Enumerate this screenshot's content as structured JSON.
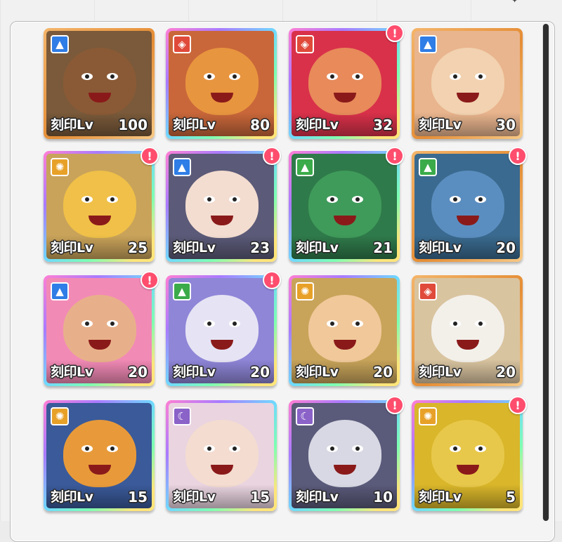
{
  "colors": {
    "water": "#2f7de6",
    "fire": "#e04a3a",
    "wood": "#3bab4a",
    "light": "#e8a128",
    "dark": "#8a62c8",
    "alert": "#ff4d6d"
  },
  "cards": [
    {
      "lv_label": "刻印Lv",
      "lv": "100",
      "element": "water",
      "elem_glyph": "▲",
      "badge": false,
      "frame": "gold",
      "bg": "#7a5a3a",
      "face": "#8a5a36"
    },
    {
      "lv_label": "刻印Lv",
      "lv": "80",
      "element": "fire",
      "elem_glyph": "◈",
      "badge": false,
      "frame": "rainbow",
      "bg": "#c9673a",
      "face": "#e8953f"
    },
    {
      "lv_label": "刻印Lv",
      "lv": "32",
      "element": "fire",
      "elem_glyph": "◈",
      "badge": true,
      "badge_text": "!",
      "frame": "rainbow",
      "bg": "#d9314a",
      "face": "#e88a5a"
    },
    {
      "lv_label": "刻印Lv",
      "lv": "30",
      "element": "water",
      "elem_glyph": "▲",
      "badge": false,
      "frame": "gold",
      "bg": "#e9b58e",
      "face": "#f2d2b0"
    },
    {
      "lv_label": "刻印Lv",
      "lv": "25",
      "element": "light",
      "elem_glyph": "✺",
      "badge": true,
      "badge_text": "!",
      "frame": "rainbow",
      "bg": "#c9a35a",
      "face": "#f0c048"
    },
    {
      "lv_label": "刻印Lv",
      "lv": "23",
      "element": "water",
      "elem_glyph": "▲",
      "badge": true,
      "badge_text": "!",
      "frame": "rainbow",
      "bg": "#5b5a78",
      "face": "#f3ddd0"
    },
    {
      "lv_label": "刻印Lv",
      "lv": "21",
      "element": "wood",
      "elem_glyph": "▲",
      "badge": true,
      "badge_text": "!",
      "frame": "rainbow",
      "bg": "#2f7a4a",
      "face": "#3f9b5a"
    },
    {
      "lv_label": "刻印Lv",
      "lv": "20",
      "element": "wood",
      "elem_glyph": "▲",
      "badge": true,
      "badge_text": "!",
      "frame": "gold",
      "bg": "#3a6a8f",
      "face": "#5b8ec0"
    },
    {
      "lv_label": "刻印Lv",
      "lv": "20",
      "element": "water",
      "elem_glyph": "▲",
      "badge": true,
      "badge_text": "!",
      "frame": "rainbow",
      "bg": "#f28ab6",
      "face": "#e8b08a"
    },
    {
      "lv_label": "刻印Lv",
      "lv": "20",
      "element": "wood",
      "elem_glyph": "▲",
      "badge": true,
      "badge_text": "!",
      "frame": "rainbow",
      "bg": "#8f86d8",
      "face": "#e6e4f4"
    },
    {
      "lv_label": "刻印Lv",
      "lv": "20",
      "element": "light",
      "elem_glyph": "✺",
      "badge": false,
      "frame": "rainbow",
      "bg": "#c8a45a",
      "face": "#f0c89a"
    },
    {
      "lv_label": "刻印Lv",
      "lv": "20",
      "element": "fire",
      "elem_glyph": "◈",
      "badge": false,
      "frame": "gold",
      "bg": "#d9c4a0",
      "face": "#f3f0ea"
    },
    {
      "lv_label": "刻印Lv",
      "lv": "15",
      "element": "light",
      "elem_glyph": "✺",
      "badge": false,
      "frame": "rainbow",
      "bg": "#3a5a9a",
      "face": "#e89a3a"
    },
    {
      "lv_label": "刻印Lv",
      "lv": "15",
      "element": "dark",
      "elem_glyph": "☾",
      "badge": false,
      "frame": "rainbow",
      "bg": "#e9d4e0",
      "face": "#f4dcd0"
    },
    {
      "lv_label": "刻印Lv",
      "lv": "10",
      "element": "dark",
      "elem_glyph": "☾",
      "badge": true,
      "badge_text": "!",
      "frame": "rainbow",
      "bg": "#5a5a7a",
      "face": "#d8d8e4"
    },
    {
      "lv_label": "刻印Lv",
      "lv": "5",
      "element": "light",
      "elem_glyph": "✺",
      "badge": true,
      "badge_text": "!",
      "frame": "rainbow",
      "bg": "#d9b62a",
      "face": "#e8c84a"
    }
  ]
}
